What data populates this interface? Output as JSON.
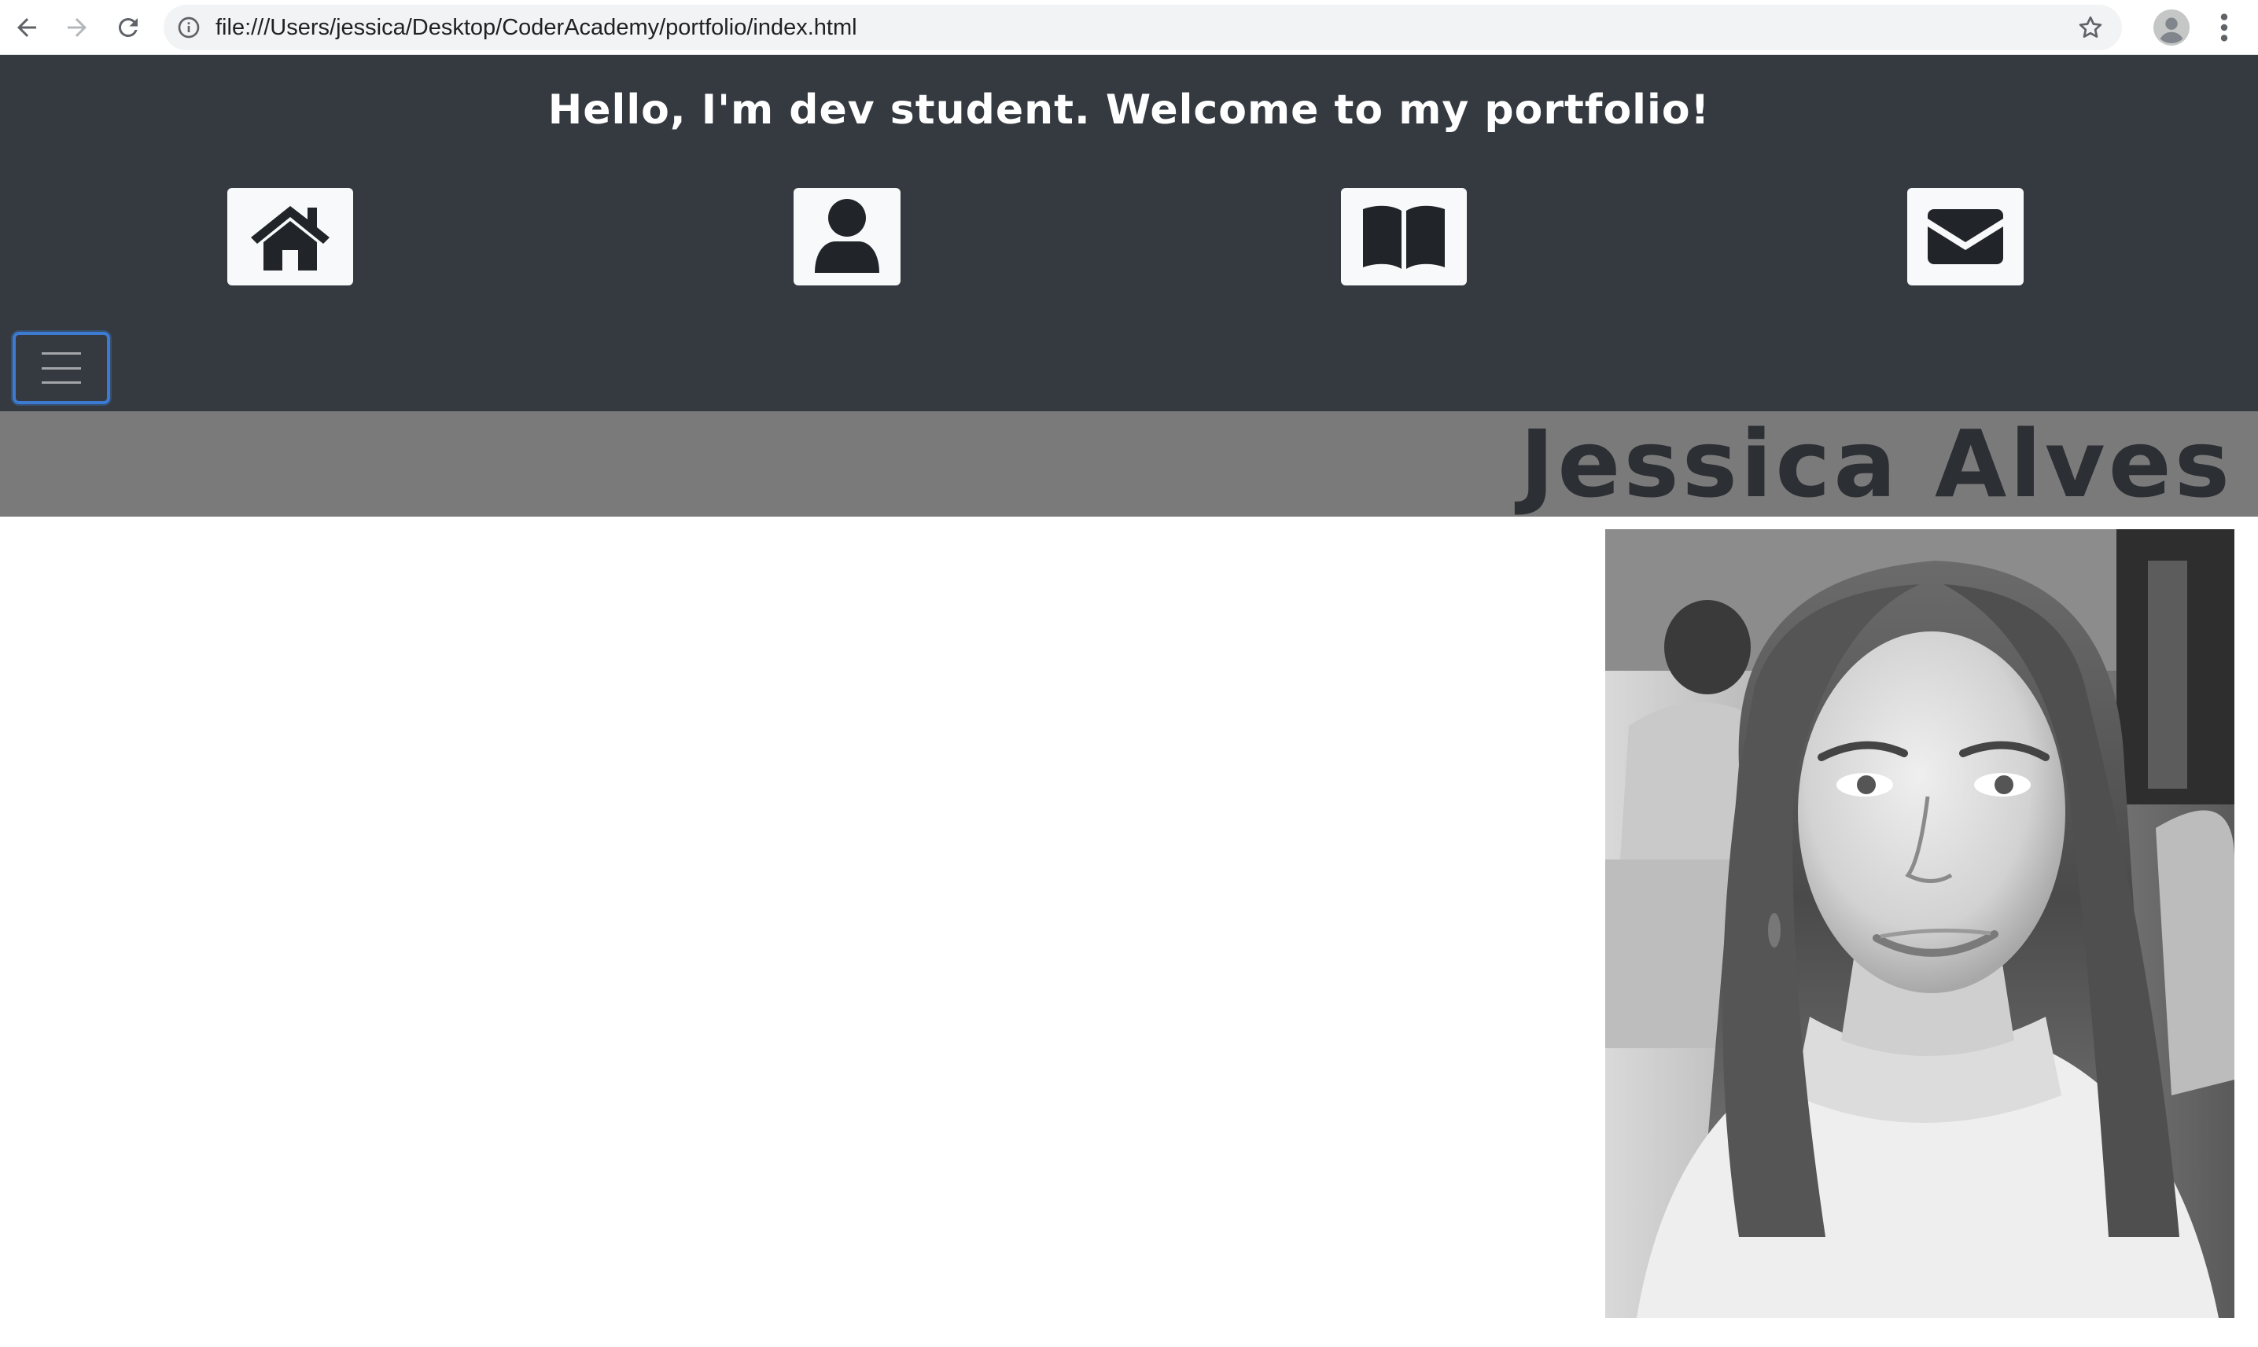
{
  "browser": {
    "url": "file:///Users/jessica/Desktop/CoderAcademy/portfolio/index.html",
    "icons": [
      "back-arrow-icon",
      "forward-arrow-icon",
      "reload-icon",
      "info-icon",
      "star-icon",
      "profile-avatar-icon",
      "kebab-menu-icon"
    ]
  },
  "header": {
    "greeting": "Hello, I'm dev student. Welcome to my portfolio!",
    "nav_icons": [
      "home-icon",
      "user-icon",
      "book-icon",
      "envelope-icon"
    ],
    "background_color": "#343a40",
    "icon_tile_color": "#f8f9fa"
  },
  "navbar_toggler": {
    "icon": "hamburger-menu-icon",
    "focus_color": "#3c7bd1"
  },
  "profile": {
    "name": "Jessica Alves",
    "name_bar_color": "#7b7a7b",
    "photo": "black-and-white portrait photo"
  }
}
